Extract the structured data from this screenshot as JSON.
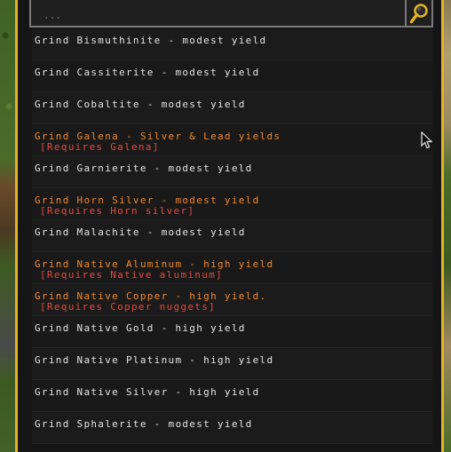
{
  "search": {
    "placeholder": "..."
  },
  "recipes": [
    {
      "label": "Grind Bismuthinite - modest yield",
      "requirement": "",
      "available": true
    },
    {
      "label": "Grind Cassiterite - modest yield",
      "requirement": "",
      "available": true
    },
    {
      "label": "Grind Cobaltite - modest yield",
      "requirement": "",
      "available": true
    },
    {
      "label": "Grind Galena - Silver & Lead yields",
      "requirement": "[Requires Galena]",
      "available": false
    },
    {
      "label": "Grind Garnierite - modest yield",
      "requirement": "",
      "available": true
    },
    {
      "label": "Grind Horn Silver - modest yield",
      "requirement": "[Requires Horn silver]",
      "available": false
    },
    {
      "label": "Grind Malachite - modest yield",
      "requirement": "",
      "available": true
    },
    {
      "label": "Grind Native Aluminum - high yield",
      "requirement": "[Requires Native aluminum]",
      "available": false
    },
    {
      "label": "Grind Native Copper - high yield.",
      "requirement": "[Requires Copper nuggets]",
      "available": false
    },
    {
      "label": "Grind Native Gold - high yield",
      "requirement": "",
      "available": true
    },
    {
      "label": "Grind Native Platinum - high yield",
      "requirement": "",
      "available": true
    },
    {
      "label": "Grind Native Silver - high yield",
      "requirement": "",
      "available": true
    },
    {
      "label": "Grind Sphalerite - modest yield",
      "requirement": "",
      "available": true
    }
  ],
  "colors": {
    "panel_border": "#e3b423",
    "available_text": "#e4e4e4",
    "unavailable_text": "#f0882f",
    "requirement_text": "#e8493c"
  },
  "icons": {
    "search": "magnifier-icon",
    "cursor": "mouse-pointer-icon"
  }
}
